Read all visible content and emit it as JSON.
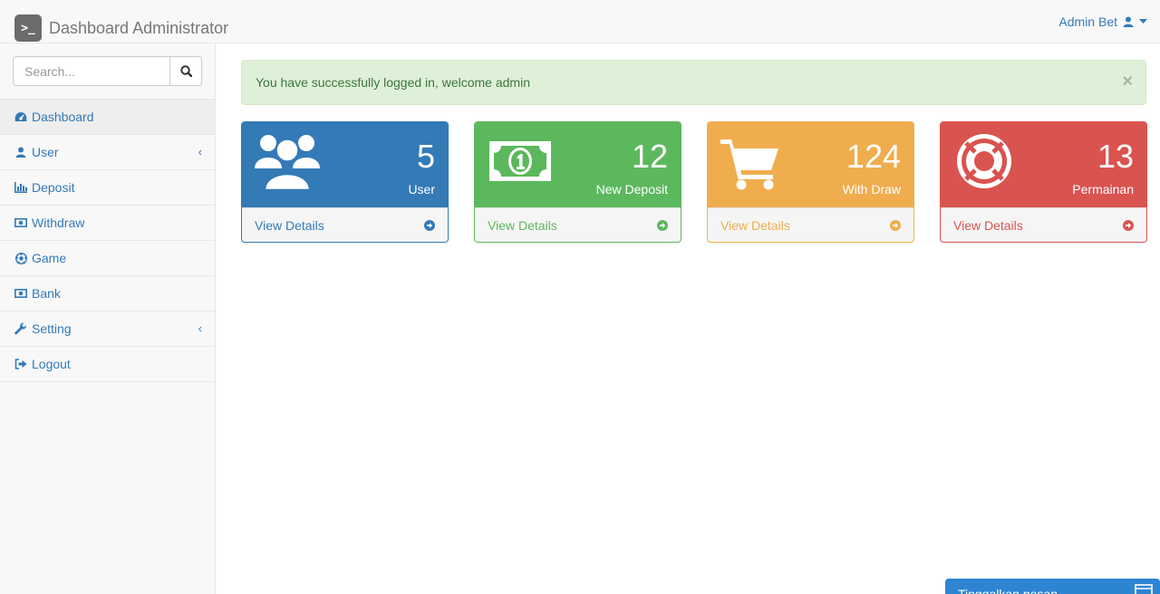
{
  "navbar": {
    "logo_glyph": ">_",
    "brand": "Dashboard Administrator",
    "user_name": "Admin Bet"
  },
  "sidebar": {
    "search_placeholder": "Search...",
    "items": [
      {
        "label": "Dashboard",
        "icon": "dashboard-icon",
        "active": true
      },
      {
        "label": "User",
        "icon": "user-icon",
        "has_submenu": true
      },
      {
        "label": "Deposit",
        "icon": "bar-chart-icon"
      },
      {
        "label": "Withdraw",
        "icon": "money-icon"
      },
      {
        "label": "Game",
        "icon": "soccer-ball-icon"
      },
      {
        "label": "Bank",
        "icon": "money-icon"
      },
      {
        "label": "Setting",
        "icon": "wrench-icon",
        "has_submenu": true
      },
      {
        "label": "Logout",
        "icon": "sign-out-icon"
      }
    ]
  },
  "alert": {
    "message": "You have successfully logged in, welcome admin",
    "close": "×"
  },
  "panels": [
    {
      "value": "5",
      "label": "User",
      "link": "View Details",
      "icon": "users-icon",
      "color": "#337ab7"
    },
    {
      "value": "12",
      "label": "New Deposit",
      "link": "View Details",
      "icon": "money-bill-icon",
      "color": "#5cb85c"
    },
    {
      "value": "124",
      "label": "With Draw",
      "link": "View Details",
      "icon": "shopping-cart-icon",
      "color": "#f0ad4e"
    },
    {
      "value": "13",
      "label": "Permainan",
      "link": "View Details",
      "icon": "life-ring-icon",
      "color": "#d9534f"
    }
  ],
  "chat": {
    "label": "Tinggalkan pesan",
    "color": "#2d84d1"
  }
}
